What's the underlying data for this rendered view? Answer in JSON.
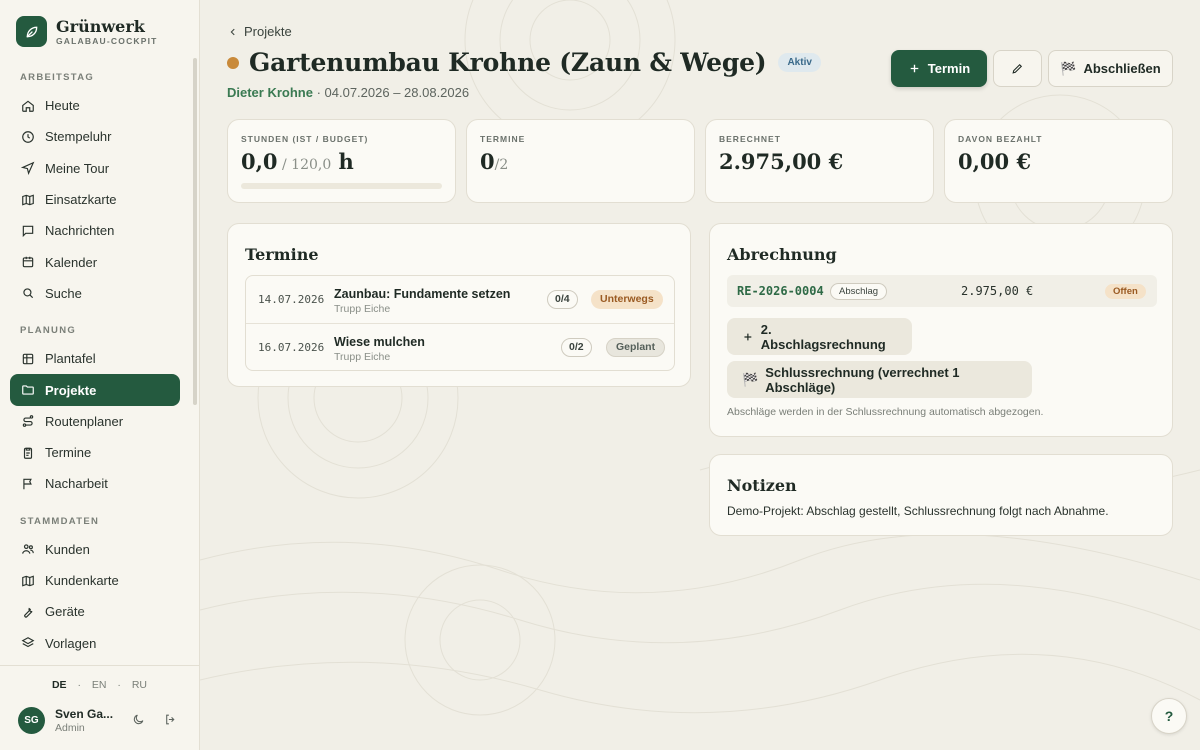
{
  "brand": {
    "name": "Grünwerk",
    "subtitle": "GALABAU-COCKPIT"
  },
  "nav": {
    "sections": [
      {
        "label": "ARBEITSTAG"
      },
      {
        "label": "PLANUNG"
      },
      {
        "label": "STAMMDATEN"
      }
    ],
    "items": [
      {
        "label": "Heute",
        "icon": "home-icon"
      },
      {
        "label": "Stempeluhr",
        "icon": "clock-icon"
      },
      {
        "label": "Meine Tour",
        "icon": "navigation-icon"
      },
      {
        "label": "Einsatzkarte",
        "icon": "map-icon"
      },
      {
        "label": "Nachrichten",
        "icon": "message-icon"
      },
      {
        "label": "Kalender",
        "icon": "calendar-icon"
      },
      {
        "label": "Suche",
        "icon": "search-icon"
      },
      {
        "label": "Plantafel",
        "icon": "grid-icon"
      },
      {
        "label": "Projekte",
        "icon": "folder-icon",
        "active": true
      },
      {
        "label": "Routenplaner",
        "icon": "route-icon"
      },
      {
        "label": "Termine",
        "icon": "clipboard-icon"
      },
      {
        "label": "Nacharbeit",
        "icon": "flag-icon"
      },
      {
        "label": "Kunden",
        "icon": "users-icon"
      },
      {
        "label": "Kundenkarte",
        "icon": "map-icon"
      },
      {
        "label": "Geräte",
        "icon": "tool-icon"
      },
      {
        "label": "Vorlagen",
        "icon": "layers-icon"
      }
    ]
  },
  "languages": {
    "de": "DE",
    "en": "EN",
    "ru": "RU",
    "sep": "·"
  },
  "user": {
    "initials": "SG",
    "name": "Sven Ga...",
    "role": "Admin"
  },
  "header": {
    "back_label": "Projekte",
    "title": "Gartenumbau Krohne (Zaun & Wege)",
    "status_badge": "Aktiv",
    "client": "Dieter Krohne",
    "date_range": " · 04.07.2026 – 28.08.2026",
    "status_color": "#c98a3a"
  },
  "actions": {
    "termin_label": "Termin",
    "close_label": "Abschließen"
  },
  "stats": {
    "hours": {
      "label": "STUNDEN (IST / BUDGET)",
      "actual": "0,0",
      "budget": " / 120,0",
      "unit": " h",
      "progress": 0.0
    },
    "termine": {
      "label": "TERMINE",
      "done": "0",
      "total": "/2"
    },
    "berechnet": {
      "label": "BERECHNET",
      "value": "2.975,00 €"
    },
    "bezahlt": {
      "label": "DAVON BEZAHLT",
      "value": "0,00 €"
    }
  },
  "termine": {
    "title": "Termine",
    "rows": [
      {
        "date": "14.07.2026",
        "name": "Zaunbau: Fundamente setzen",
        "team": "Trupp Eiche",
        "count": "0/4",
        "status": "Unterwegs"
      },
      {
        "date": "16.07.2026",
        "name": "Wiese mulchen",
        "team": "Trupp Eiche",
        "count": "0/2",
        "status": "Geplant"
      }
    ]
  },
  "abrechnung": {
    "title": "Abrechnung",
    "invoice": {
      "number": "RE-2026-0004",
      "type": "Abschlag",
      "amount": "2.975,00 €",
      "state": "Offen"
    },
    "btn_abschlag": "2. Abschlagsrechnung",
    "btn_schluss": "Schlussrechnung (verrechnet 1 Abschläge)",
    "hint": "Abschläge werden in der Schlussrechnung automatisch abgezogen."
  },
  "notizen": {
    "title": "Notizen",
    "text": "Demo-Projekt: Abschlag gestellt, Schlussrechnung folgt nach Abnahme."
  },
  "help_label": "?",
  "colors": {
    "primary": "#245a3f",
    "accent_green": "#3a7a52",
    "warning": "#c98a3a"
  }
}
